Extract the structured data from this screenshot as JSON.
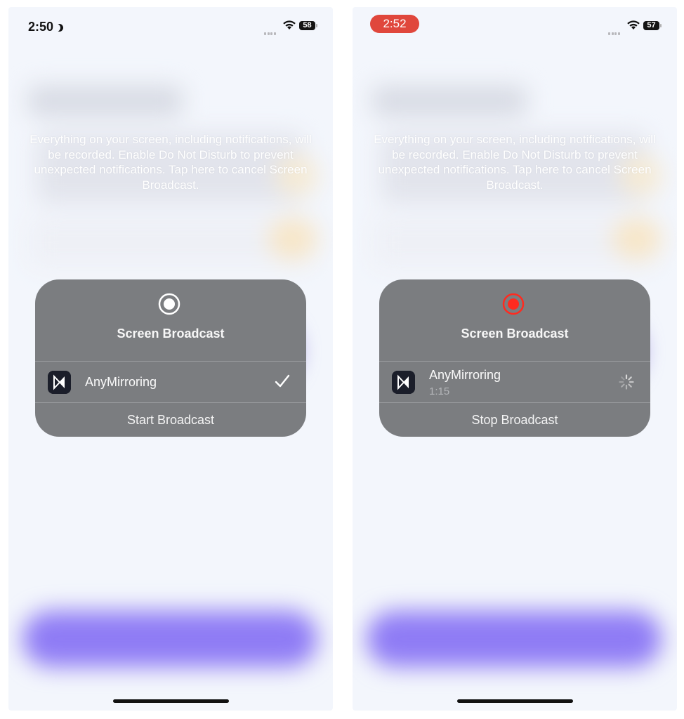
{
  "left_screen": {
    "status": {
      "time": "2:50",
      "battery": "58"
    },
    "notice": "Everything on your screen, including notifications, will be recorded. Enable Do Not Disturb to prevent unexpected notifications. Tap here to cancel Screen Broadcast.",
    "dialog": {
      "title": "Screen Broadcast",
      "app_name": "AnyMirroring",
      "action_label": "Start Broadcast"
    }
  },
  "right_screen": {
    "status": {
      "time": "2:52",
      "battery": "57"
    },
    "notice": "Everything on your screen, including notifications, will be recorded. Enable Do Not Disturb to prevent unexpected notifications. Tap here to cancel Screen Broadcast.",
    "dialog": {
      "title": "Screen Broadcast",
      "app_name": "AnyMirroring",
      "duration": "1:15",
      "action_label": "Stop Broadcast"
    }
  },
  "colors": {
    "recording_red": "#e0473c",
    "dialog_bg": "#7b7d80",
    "accent_purple": "#8f7cf5"
  }
}
